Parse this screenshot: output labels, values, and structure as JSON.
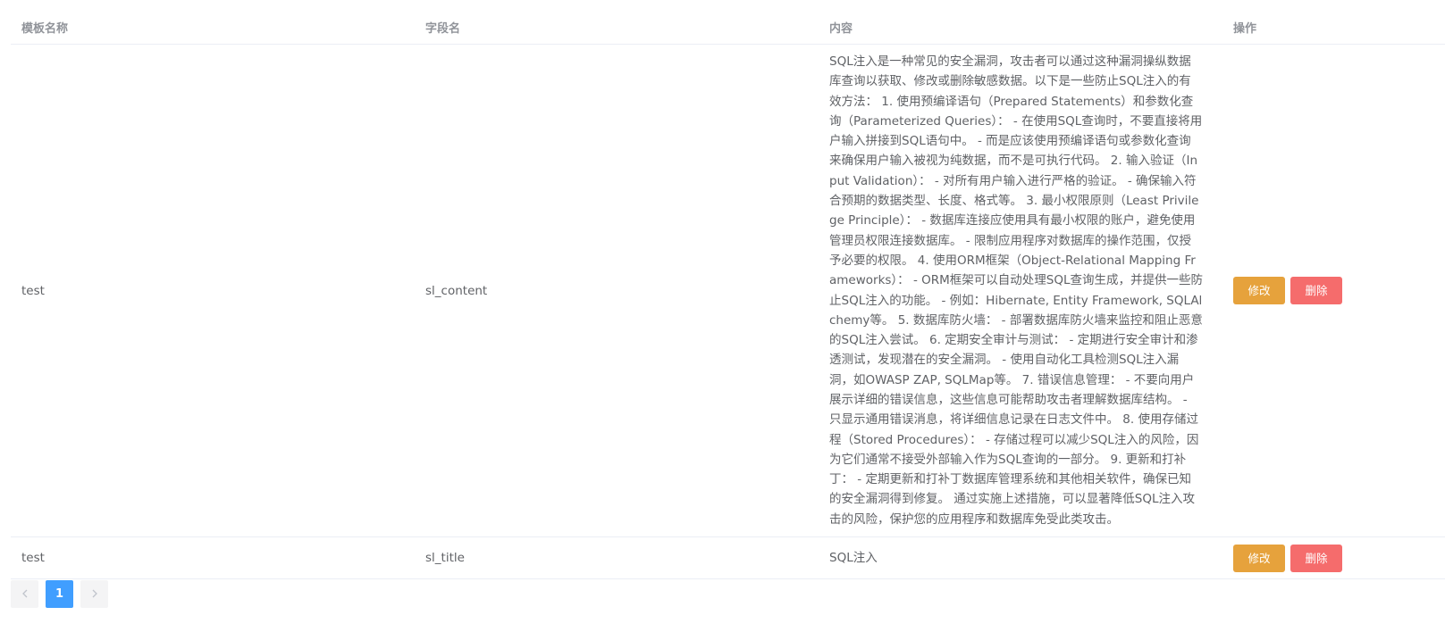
{
  "table": {
    "columns": [
      "模板名称",
      "字段名",
      "内容",
      "操作"
    ],
    "rows": [
      {
        "template_name": "test",
        "field_name": "sl_content",
        "content": "SQL注入是一种常见的安全漏洞，攻击者可以通过这种漏洞操纵数据库查询以获取、修改或删除敏感数据。以下是一些防止SQL注入的有效方法： 1. 使用预编译语句（Prepared Statements）和参数化查询（Parameterized Queries）： - 在使用SQL查询时，不要直接将用户输入拼接到SQL语句中。 - 而是应该使用预编译语句或参数化查询来确保用户输入被视为纯数据，而不是可执行代码。 2. 输入验证（Input Validation）： - 对所有用户输入进行严格的验证。 - 确保输入符合预期的数据类型、长度、格式等。 3. 最小权限原则（Least Privilege Principle）： - 数据库连接应使用具有最小权限的账户，避免使用管理员权限连接数据库。 - 限制应用程序对数据库的操作范围，仅授予必要的权限。 4. 使用ORM框架（Object-Relational Mapping Frameworks）： - ORM框架可以自动处理SQL查询生成，并提供一些防止SQL注入的功能。 - 例如：Hibernate, Entity Framework, SQLAlchemy等。 5. 数据库防火墙： - 部署数据库防火墙来监控和阻止恶意的SQL注入尝试。 6. 定期安全审计与测试： - 定期进行安全审计和渗透测试，发现潜在的安全漏洞。 - 使用自动化工具检测SQL注入漏洞，如OWASP ZAP, SQLMap等。 7. 错误信息管理： - 不要向用户展示详细的错误信息，这些信息可能帮助攻击者理解数据库结构。 - 只显示通用错误消息，将详细信息记录在日志文件中。 8. 使用存储过程（Stored Procedures）： - 存储过程可以减少SQL注入的风险，因为它们通常不接受外部输入作为SQL查询的一部分。 9. 更新和打补丁： - 定期更新和打补丁数据库管理系统和其他相关软件，确保已知的安全漏洞得到修复。 通过实施上述措施，可以显著降低SQL注入攻击的风险，保护您的应用程序和数据库免受此类攻击。",
        "edit_label": "修改",
        "delete_label": "删除"
      },
      {
        "template_name": "test",
        "field_name": "sl_title",
        "content": "SQL注入",
        "edit_label": "修改",
        "delete_label": "删除"
      }
    ]
  },
  "pagination": {
    "prev_icon": "chevron-left-icon",
    "current_page": "1",
    "next_icon": "chevron-right-icon"
  },
  "colors": {
    "edit_button": "#e6a23c",
    "delete_button": "#f56c6c",
    "active_page": "#409eff",
    "header_text": "#909399",
    "body_text": "#606266"
  }
}
